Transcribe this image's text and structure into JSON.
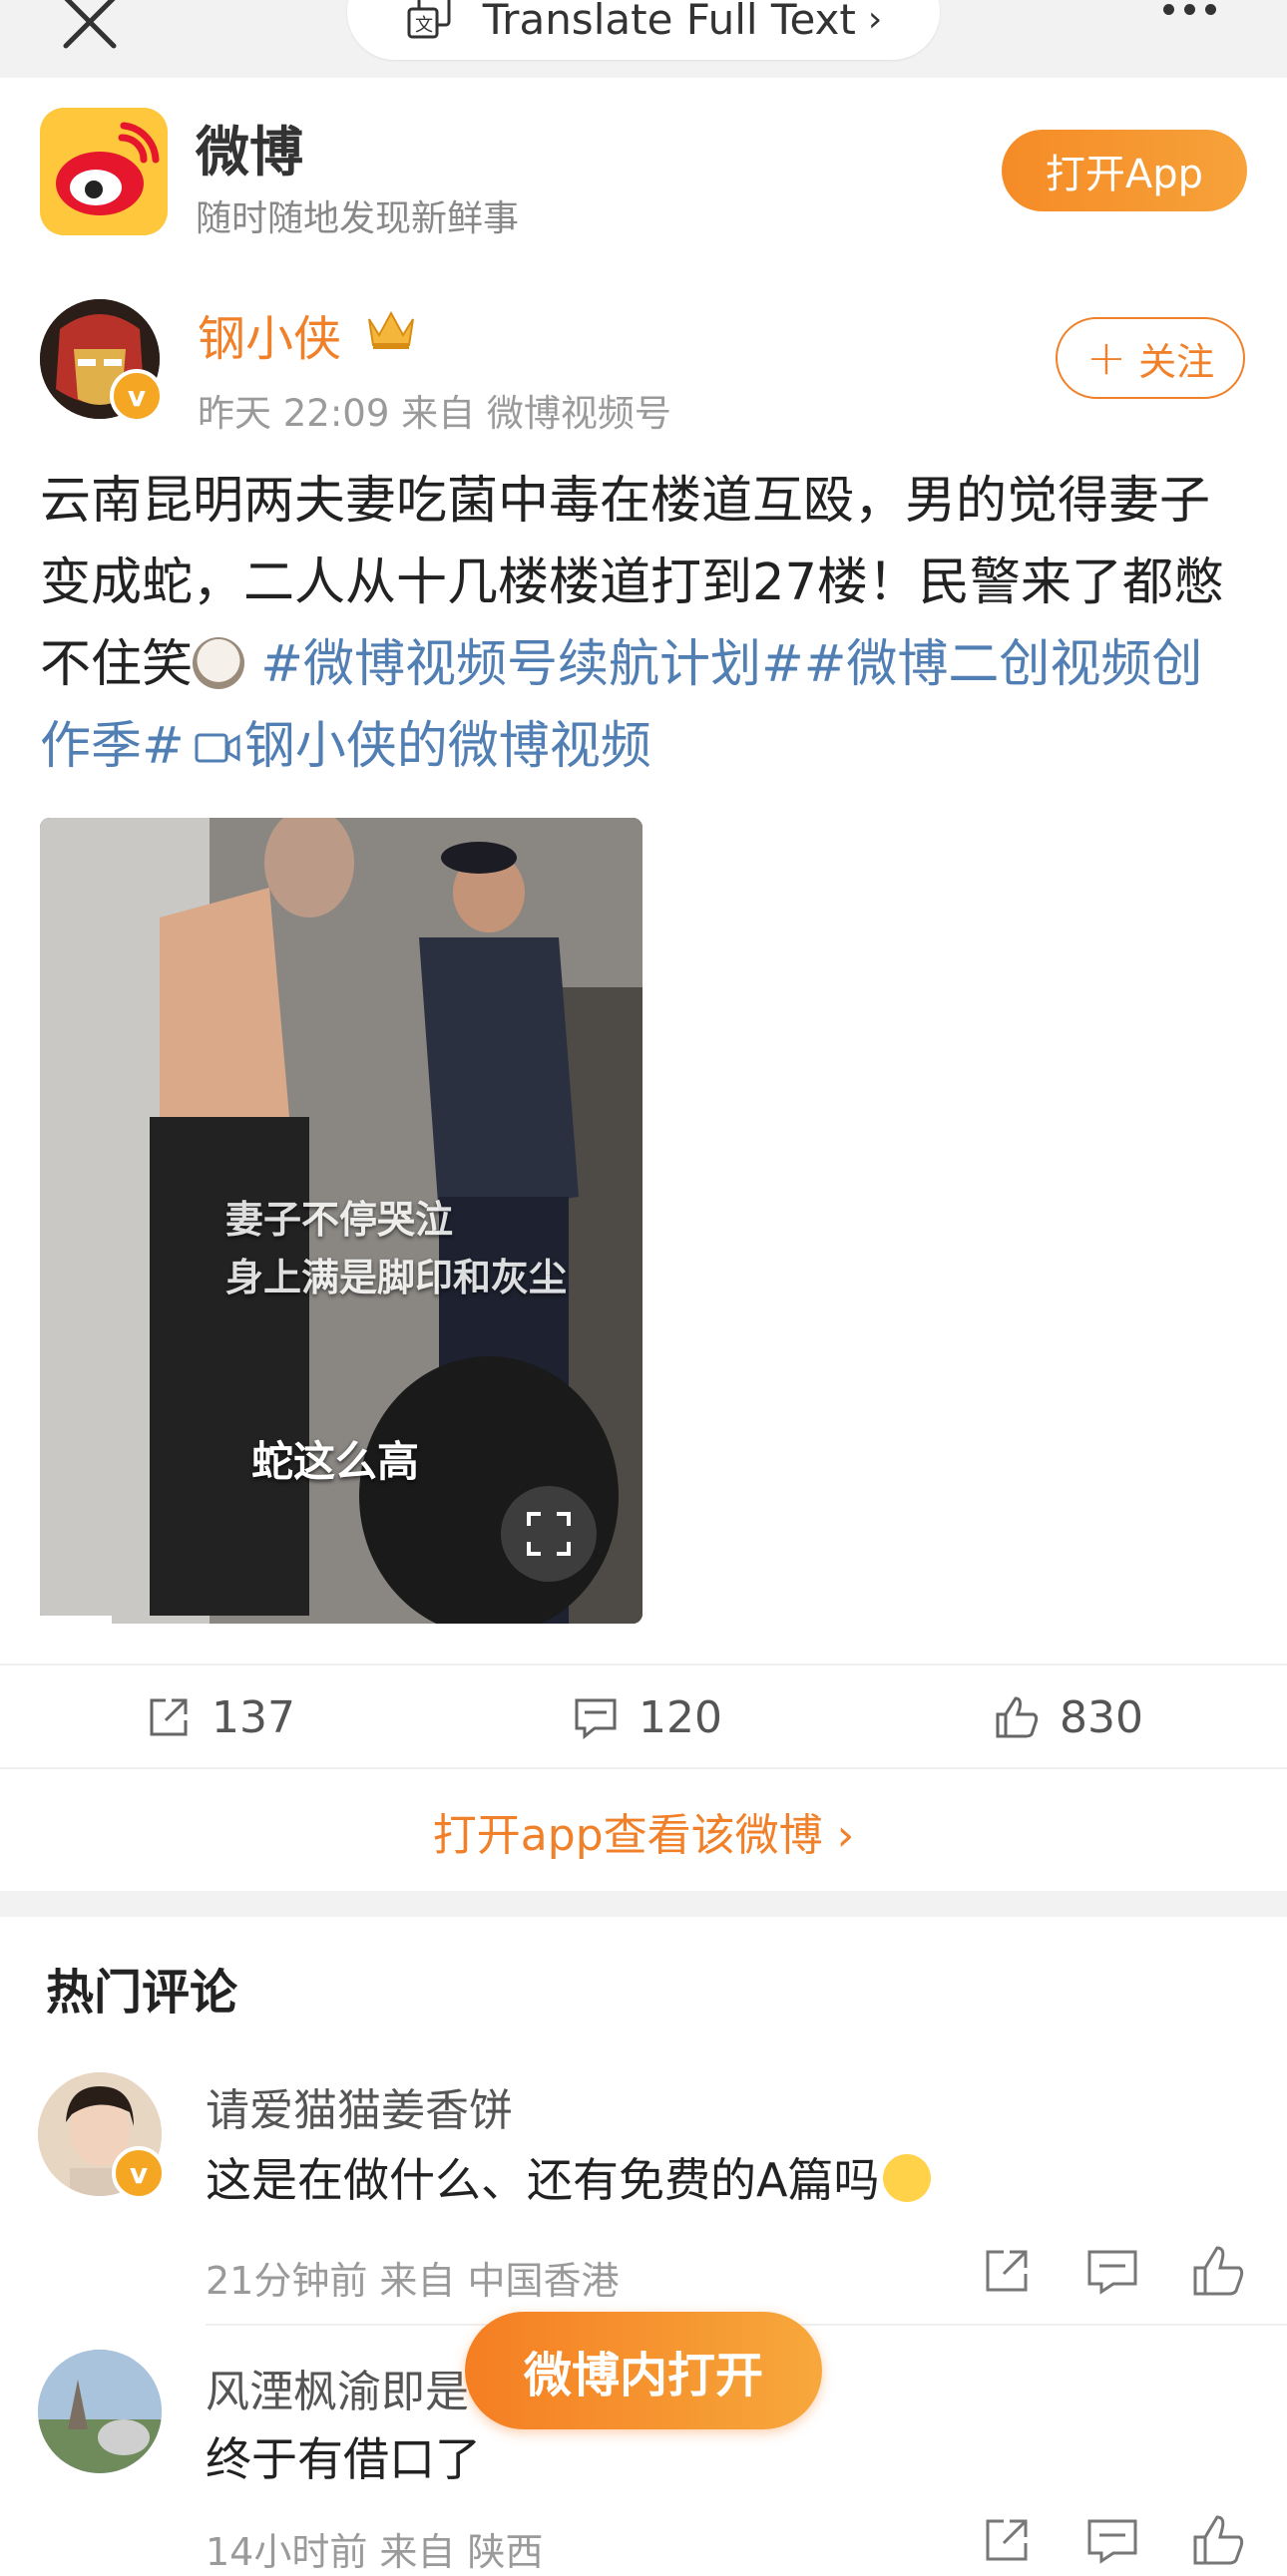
{
  "browser": {
    "translate_label": "Translate Full Text",
    "translate_chevron": "›"
  },
  "app_banner": {
    "name": "微博",
    "slogan": "随时随地发现新鲜事",
    "open_button": "打开App"
  },
  "post": {
    "author": "钢小侠",
    "vip_badge": "v",
    "time": "昨天 22:09",
    "source": "来自 微博视频号",
    "follow_label": "关注",
    "text_plain": "云南昆明两夫妻吃菌中毒在楼道互殴，男的觉得妻子变成蛇，二人从十几楼楼道打到27楼！民警来了都憋不住笑",
    "tag1": "#微博视频号续航计划#",
    "tag2": "#微博二创视频创作季#",
    "video_link": "钢小侠的微博视频",
    "video": {
      "caption1": "妻子不停哭泣",
      "caption2": "身上满是脚印和灰尘",
      "caption3": "蛇这么高",
      "progress": 0.12
    },
    "stats": {
      "reposts": "137",
      "comments": "120",
      "likes": "830"
    },
    "open_in_app": "打开app查看该微博 ›"
  },
  "comments": {
    "title": "热门评论",
    "items": [
      {
        "name": "请爱猫猫姜香饼",
        "text": "这是在做什么、还有免费的A篇吗",
        "meta": "21分钟前 来自 中国香港",
        "vip_badge": "v"
      },
      {
        "name": "风湮枫渝即是",
        "text": "终于有借口了",
        "meta": "14小时前 来自 陕西"
      }
    ]
  },
  "floating_button": "微博内打开",
  "colors": {
    "accent": "#f0812a",
    "link": "#517fb4"
  },
  "icons": [
    "close-icon",
    "translate-icon",
    "more-icon",
    "weibo-logo",
    "crown-icon",
    "repost-icon",
    "comment-icon",
    "like-icon",
    "fullscreen-icon",
    "video-icon"
  ]
}
